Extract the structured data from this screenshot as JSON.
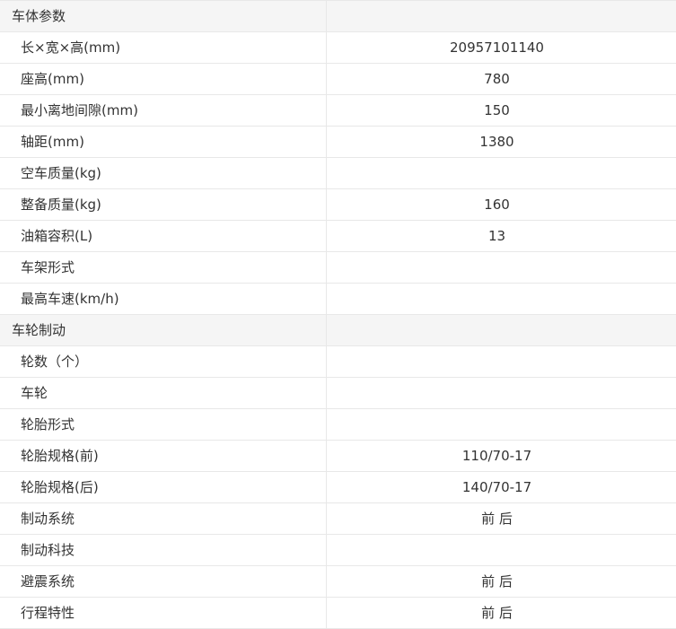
{
  "rows": [
    {
      "label": "车体参数",
      "value": "",
      "section": true
    },
    {
      "label": "长×宽×高(mm)",
      "value": "20957101140"
    },
    {
      "label": "座高(mm)",
      "value": "780"
    },
    {
      "label": "最小离地间隙(mm)",
      "value": "150"
    },
    {
      "label": "轴距(mm)",
      "value": "1380"
    },
    {
      "label": "空车质量(kg)",
      "value": ""
    },
    {
      "label": "整备质量(kg)",
      "value": "160"
    },
    {
      "label": "油箱容积(L)",
      "value": "13"
    },
    {
      "label": "车架形式",
      "value": ""
    },
    {
      "label": "最高车速(km/h)",
      "value": ""
    },
    {
      "label": "车轮制动",
      "value": "",
      "section": true
    },
    {
      "label": "轮数（个）",
      "value": ""
    },
    {
      "label": "车轮",
      "value": ""
    },
    {
      "label": "轮胎形式",
      "value": ""
    },
    {
      "label": "轮胎规格(前)",
      "value": "110/70-17"
    },
    {
      "label": "轮胎规格(后)",
      "value": "140/70-17"
    },
    {
      "label": "制动系统",
      "value": "前 后"
    },
    {
      "label": "制动科技",
      "value": ""
    },
    {
      "label": "避震系统",
      "value": "前 后"
    },
    {
      "label": "行程特性",
      "value": "前 后"
    }
  ]
}
